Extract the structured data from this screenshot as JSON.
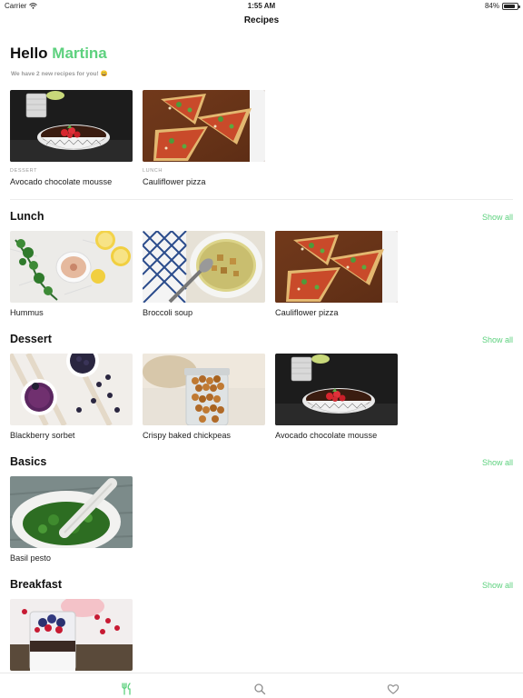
{
  "status": {
    "carrier": "Carrier",
    "time": "1:55 AM",
    "battery": "84%",
    "battery_level": 0.84
  },
  "nav": {
    "title": "Recipes"
  },
  "greeting": {
    "hello": "Hello",
    "name": "Martina",
    "subtitle": "We have 2 new recipes for you! 😀"
  },
  "featured": [
    {
      "category": "DESSERT",
      "title": "Avocado chocolate mousse"
    },
    {
      "category": "LUNCH",
      "title": "Cauliflower pizza"
    }
  ],
  "show_all_label": "Show all",
  "sections": [
    {
      "title": "Lunch",
      "items": [
        "Hummus",
        "Broccoli soup",
        "Cauliflower pizza"
      ]
    },
    {
      "title": "Dessert",
      "items": [
        "Blackberry sorbet",
        "Crispy baked chickpeas",
        "Avocado chocolate mousse"
      ]
    },
    {
      "title": "Basics",
      "items": [
        "Basil pesto"
      ]
    },
    {
      "title": "Breakfast",
      "items": [
        ""
      ]
    }
  ],
  "tabs": [
    {
      "icon": "utensils-icon",
      "active": true,
      "color": "#5dd17e"
    },
    {
      "icon": "search-icon",
      "active": false,
      "color": "#8e8e8e"
    },
    {
      "icon": "heart-icon",
      "active": false,
      "color": "#8e8e8e"
    }
  ],
  "colors": {
    "accent": "#5dd17e"
  }
}
